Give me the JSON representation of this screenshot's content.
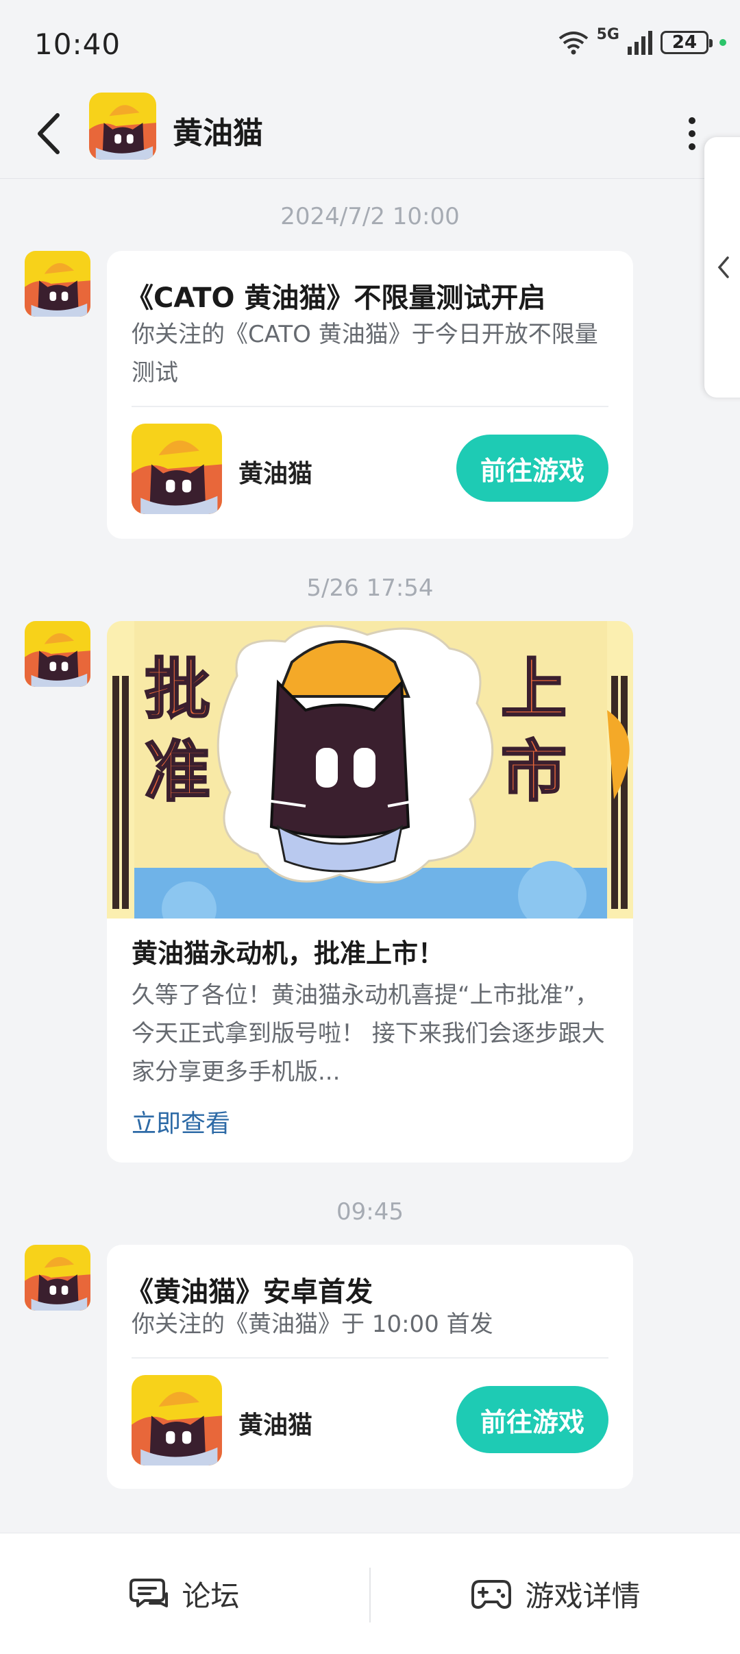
{
  "status": {
    "time": "10:40",
    "battery": "24",
    "network": "5G"
  },
  "header": {
    "title": "黄油猫"
  },
  "messages": [
    {
      "timestamp": "2024/7/2  10:00",
      "title": "《CATO 黄油猫》不限量测试开启",
      "desc": "你关注的《CATO 黄油猫》于今日开放不限量测试",
      "game_name": "黄油猫",
      "button": "前往游戏"
    },
    {
      "timestamp": "5/26  17:54",
      "banner_left": "批准",
      "banner_right": "上市",
      "title": "黄油猫永动机，批准上市！",
      "desc": "久等了各位！黄油猫永动机喜提“上市批准”，今天正式拿到版号啦！ 接下来我们会逐步跟大家分享更多手机版...",
      "link": "立即查看"
    },
    {
      "timestamp": "09:45",
      "title": "《黄油猫》安卓首发",
      "desc": "你关注的《黄油猫》于 10:00 首发",
      "game_name": "黄油猫",
      "button": "前往游戏"
    }
  ],
  "bottom_bar": {
    "forum": "论坛",
    "game_details": "游戏详情"
  },
  "icons": {
    "back": "chevron-left-icon",
    "more": "more-vertical-icon",
    "forum": "chat-bubble-icon",
    "game": "gamepad-icon",
    "side": "chevron-left-icon"
  },
  "colors": {
    "accent": "#1ecbb4",
    "link": "#2d6aa6",
    "background": "#f3f4f6"
  }
}
